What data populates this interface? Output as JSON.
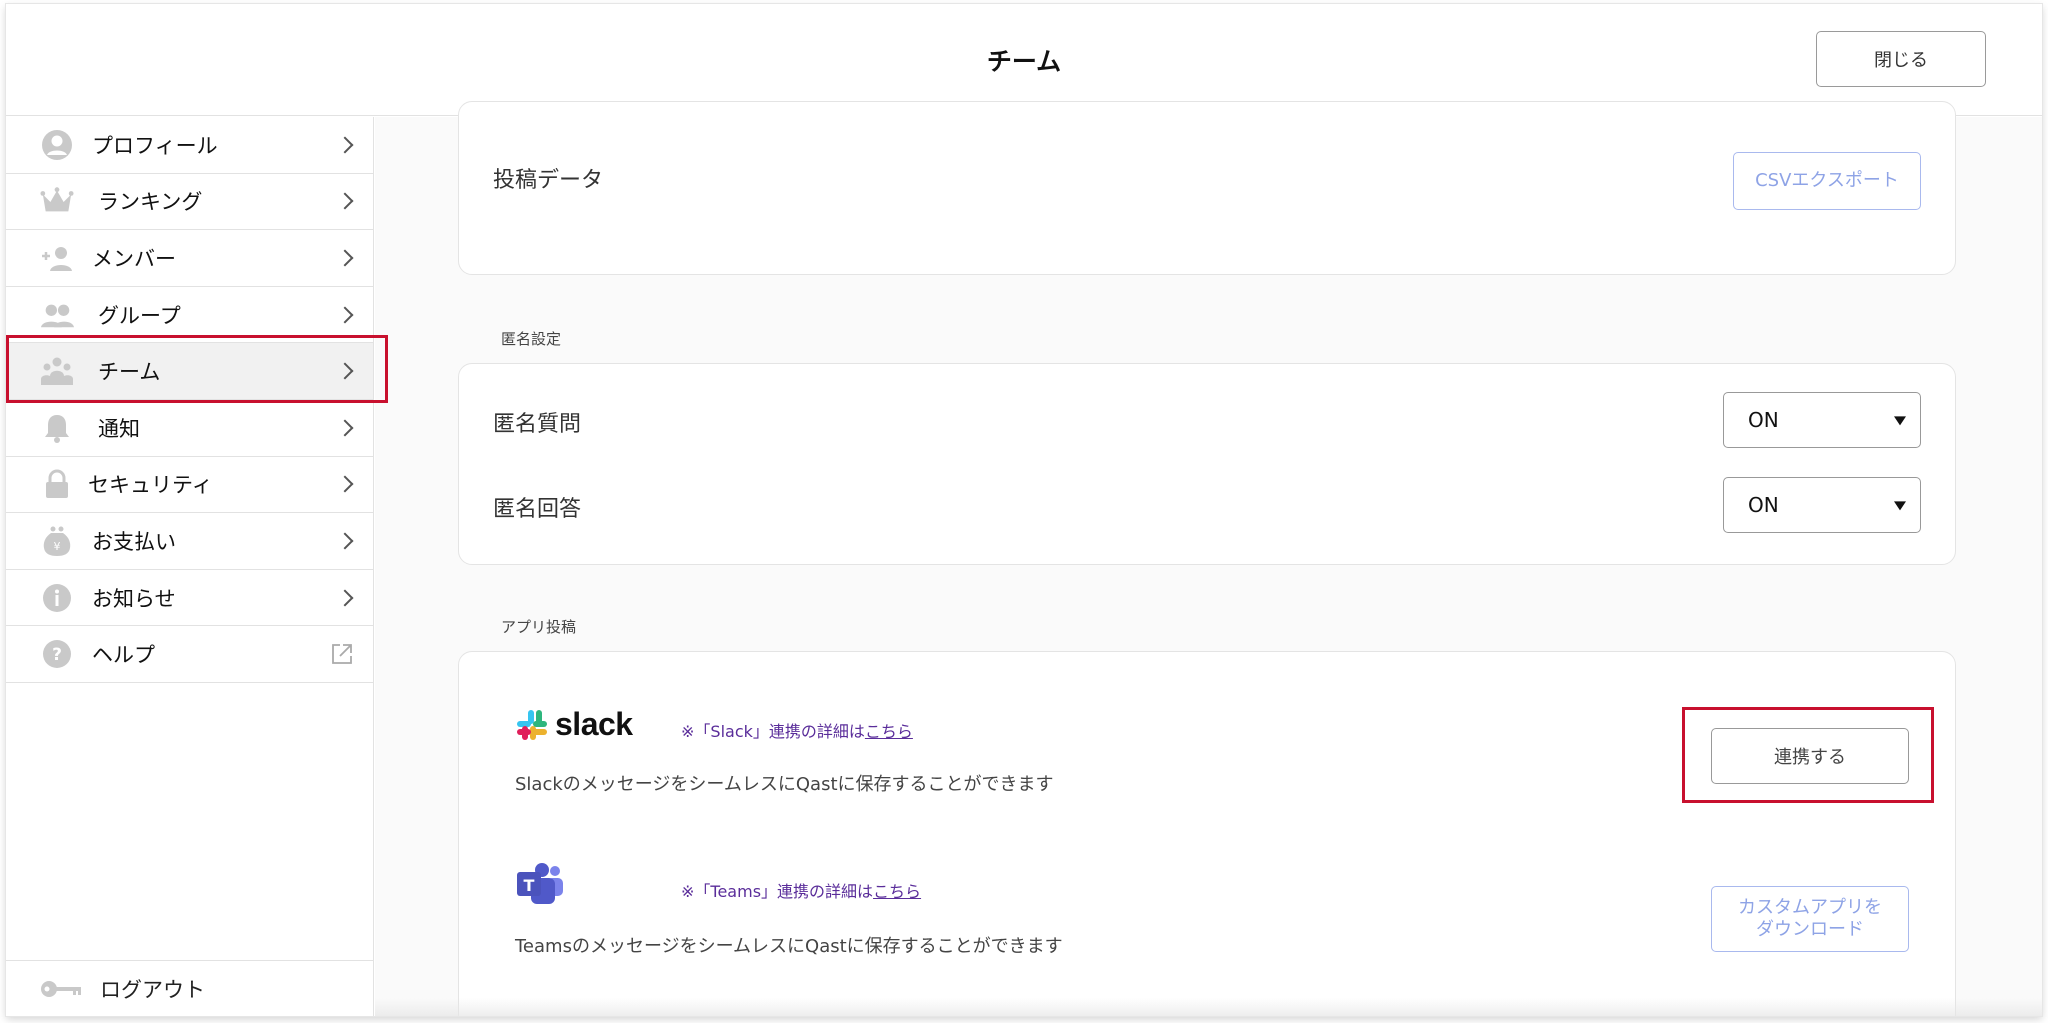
{
  "header": {
    "title": "チーム",
    "close_label": "閉じる"
  },
  "sidebar": {
    "items": [
      {
        "label": "プロフィール",
        "icon": "user-circle-icon"
      },
      {
        "label": "ランキング",
        "icon": "crown-icon"
      },
      {
        "label": "メンバー",
        "icon": "add-user-icon"
      },
      {
        "label": "グループ",
        "icon": "group-icon"
      },
      {
        "label": "チーム",
        "icon": "team-icon",
        "active": true
      },
      {
        "label": "通知",
        "icon": "bell-icon"
      },
      {
        "label": "セキュリティ",
        "icon": "lock-icon"
      },
      {
        "label": "お支払い",
        "icon": "money-bag-icon"
      },
      {
        "label": "お知らせ",
        "icon": "info-icon"
      },
      {
        "label": "ヘルプ",
        "icon": "help-icon",
        "external": true
      }
    ],
    "logout_label": "ログアウト"
  },
  "main": {
    "post_data": {
      "label": "投稿データ",
      "button": "CSVエクスポート"
    },
    "anonymous": {
      "section_label": "匿名設定",
      "question_label": "匿名質問",
      "question_value": "ON",
      "answer_label": "匿名回答",
      "answer_value": "ON"
    },
    "app_posting": {
      "section_label": "アプリ投稿",
      "slack": {
        "logo_text": "slack",
        "note_prefix": "※「Slack」連携の詳細は",
        "note_link": "こちら",
        "description": "SlackのメッセージをシームレスにQastに保存することができます",
        "button": "連携する"
      },
      "teams": {
        "note_prefix": "※「Teams」連携の詳細は",
        "note_link": "こちら",
        "description": "TeamsのメッセージをシームレスにQastに保存することができます",
        "button_line1": "カスタムアプリを",
        "button_line2": "ダウンロード"
      }
    }
  },
  "colors": {
    "highlight": "#c8102e",
    "accent_button": "#8ea3e6",
    "link": "#5a2d9a"
  }
}
